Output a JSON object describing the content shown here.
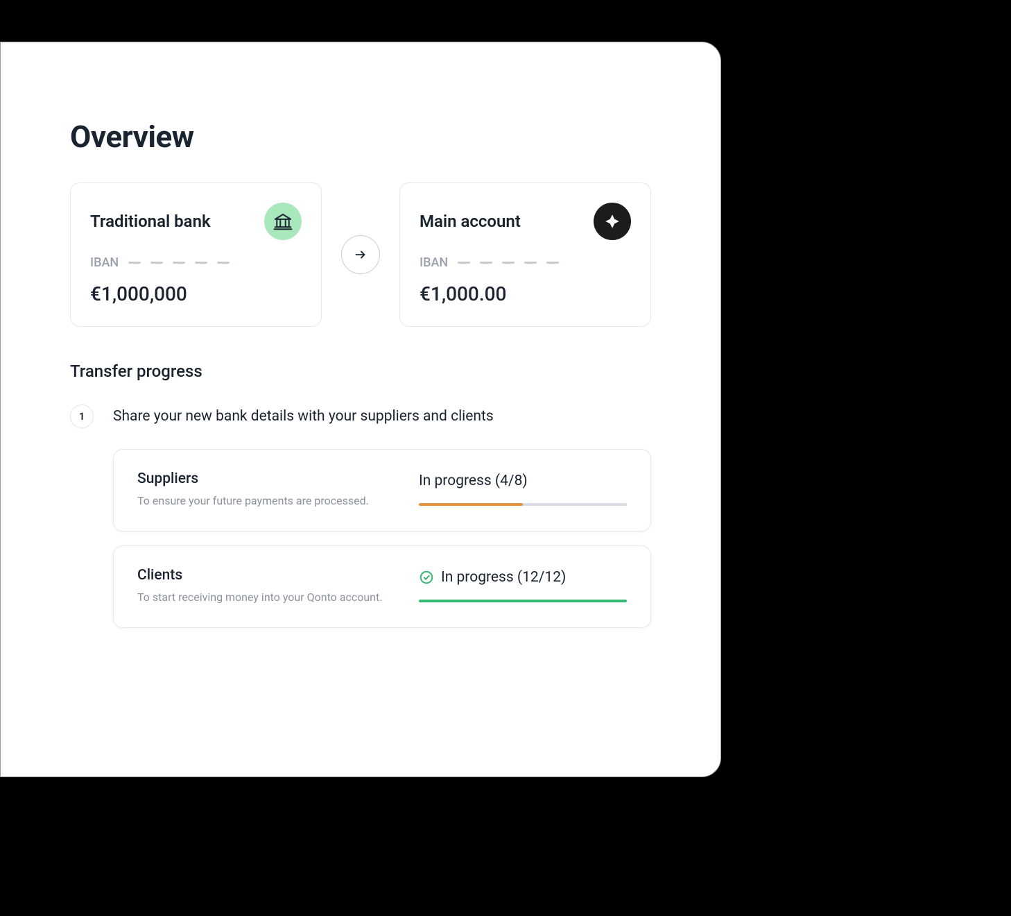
{
  "page": {
    "title": "Overview"
  },
  "accounts": {
    "source": {
      "title": "Traditional bank",
      "iban_label": "IBAN",
      "balance": "€1,000,000"
    },
    "destination": {
      "title": "Main account",
      "iban_label": "IBAN",
      "balance": "€1,000.00"
    }
  },
  "transfer": {
    "section_title": "Transfer progress",
    "step": {
      "number": "1",
      "text": "Share your new bank details with your suppliers and clients"
    },
    "cards": {
      "suppliers": {
        "title": "Suppliers",
        "description": "To ensure your future payments are processed.",
        "status": "In progress (4/8)",
        "done": 4,
        "total": 8,
        "color": "#e8913a"
      },
      "clients": {
        "title": "Clients",
        "description": "To start receiving money into your Qonto account.",
        "status": "In progress (12/12)",
        "done": 12,
        "total": 12,
        "color": "#37b772"
      }
    }
  },
  "colors": {
    "progress_track": "#d8dde3",
    "text_primary": "#1a2330",
    "text_muted": "#8b929c"
  }
}
